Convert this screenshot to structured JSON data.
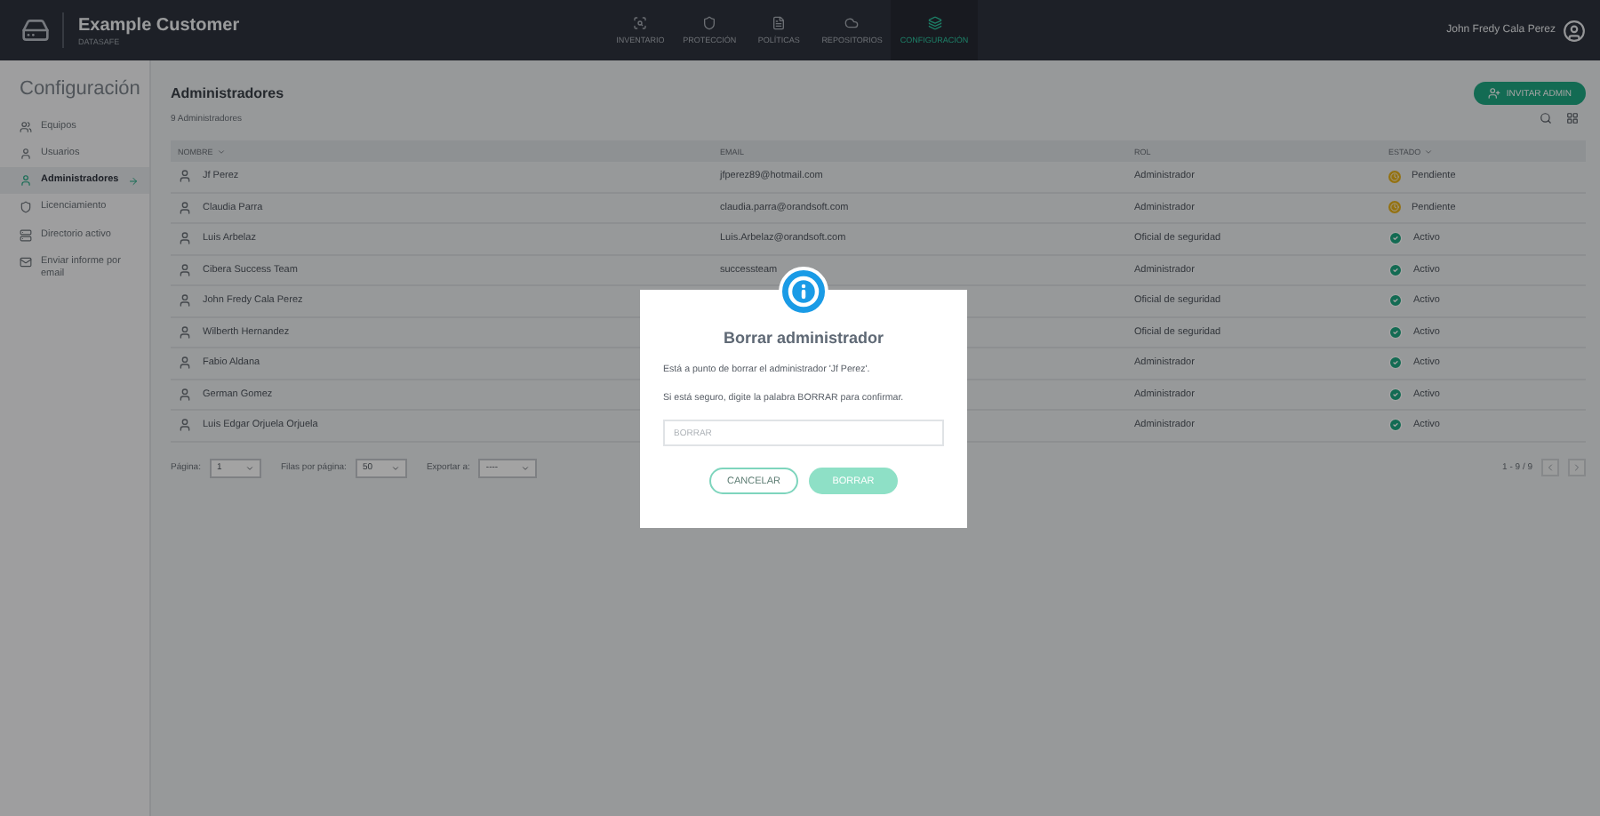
{
  "header": {
    "brand": "Example Customer",
    "brand_sub": "DATASAFE",
    "user": "John Fredy Cala Perez",
    "nav": [
      {
        "label": "INVENTARIO",
        "selected": false
      },
      {
        "label": "PROTECCIÓN",
        "selected": false
      },
      {
        "label": "POLÍTICAS",
        "selected": false
      },
      {
        "label": "REPOSITORIOS",
        "selected": false
      },
      {
        "label": "CONFIGURACIÓN",
        "selected": true
      }
    ]
  },
  "sidebar": {
    "title": "Configuración",
    "items": [
      {
        "label": "Equipos",
        "selected": false
      },
      {
        "label": "Usuarios",
        "selected": false
      },
      {
        "label": "Administradores",
        "selected": true
      },
      {
        "label": "Licenciamiento",
        "selected": false
      },
      {
        "label": "Directorio activo",
        "selected": false
      },
      {
        "label": "Enviar informe por email",
        "selected": false
      }
    ]
  },
  "page": {
    "title": "Administradores",
    "count": "9 Administradores",
    "invite": "INVITAR ADMIN"
  },
  "table": {
    "columns": [
      {
        "label": "NOMBRE",
        "sorted": true
      },
      {
        "label": "EMAIL",
        "sorted": false
      },
      {
        "label": "ROL",
        "sorted": false
      },
      {
        "label": "ESTADO",
        "sorted": true
      }
    ],
    "rows": [
      {
        "name": "Jf Perez",
        "email": "jfperez89@hotmail.com",
        "role": "Administrador",
        "status": {
          "kind": "pending",
          "label": "Pendiente"
        }
      },
      {
        "name": "Claudia Parra",
        "email": "claudia.parra@orandsoft.com",
        "role": "Administrador",
        "status": {
          "kind": "pending",
          "label": "Pendiente"
        }
      },
      {
        "name": "Luis Arbelaz",
        "email": "Luis.Arbelaz@orandsoft.com",
        "role": "Oficial de seguridad",
        "status": {
          "kind": "active",
          "label": "Activo"
        }
      },
      {
        "name": "Cibera Success Team",
        "email": "successteam",
        "role": "Administrador",
        "status": {
          "kind": "active",
          "label": "Activo"
        }
      },
      {
        "name": "John Fredy Cala Perez",
        "role": "Oficial de seguridad",
        "status": {
          "kind": "active",
          "label": "Activo"
        }
      },
      {
        "name": "Wilberth Hernandez",
        "role": "Oficial de seguridad",
        "status": {
          "kind": "active",
          "label": "Activo"
        }
      },
      {
        "name": "Fabio Aldana",
        "role": "Administrador",
        "status": {
          "kind": "active",
          "label": "Activo"
        }
      },
      {
        "name": "German Gomez",
        "role": "Administrador",
        "status": {
          "kind": "active",
          "label": "Activo"
        }
      },
      {
        "name": "Luis Edgar Orjuela Orjuela",
        "role": "Administrador",
        "status": {
          "kind": "active",
          "label": "Activo"
        }
      }
    ]
  },
  "footer": {
    "page_label": "Página:",
    "page_value": "1",
    "rows_label": "Filas por página:",
    "rows_value": "50",
    "export_label": "Exportar a:",
    "export_value": "----",
    "range": "1 - 9 / 9"
  },
  "modal": {
    "title": "Borrar administrador",
    "message": "Está a punto de borrar el administrador 'Jf Perez'.",
    "instruction": "Si está seguro, digite la palabra BORRAR para confirmar.",
    "placeholder": "BORRAR",
    "cancel": "CANCELAR",
    "confirm": {
      "label": "BORRAR",
      "disabled": true
    }
  }
}
